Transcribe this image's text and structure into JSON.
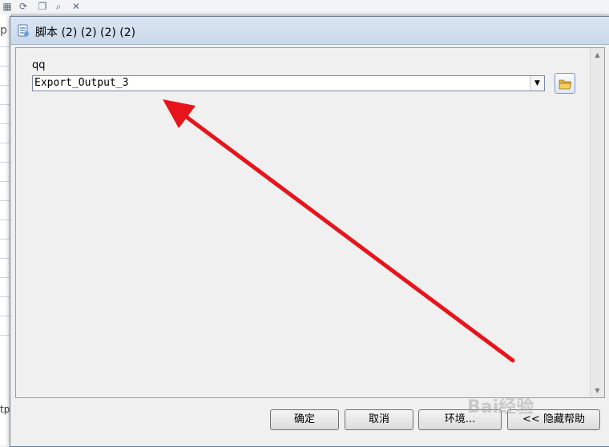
{
  "background": {
    "fragment_top": "p",
    "fragment_bottom": "tp"
  },
  "dialog": {
    "title": "脚本 (2) (2) (2) (2)",
    "parameter": {
      "label": "qq",
      "value": "Export_Output_3"
    },
    "buttons": {
      "ok": "确定",
      "cancel": "取消",
      "environments": "环境...",
      "hide_help": "<< 隐藏帮助"
    }
  },
  "watermark": "Bai经验",
  "icons": {
    "title": "script-icon",
    "browse": "folder-open-icon",
    "dropdown": "chevron-down-icon"
  },
  "colors": {
    "annotation_arrow": "#e8141b",
    "titlebar": "#c9d8ea"
  }
}
